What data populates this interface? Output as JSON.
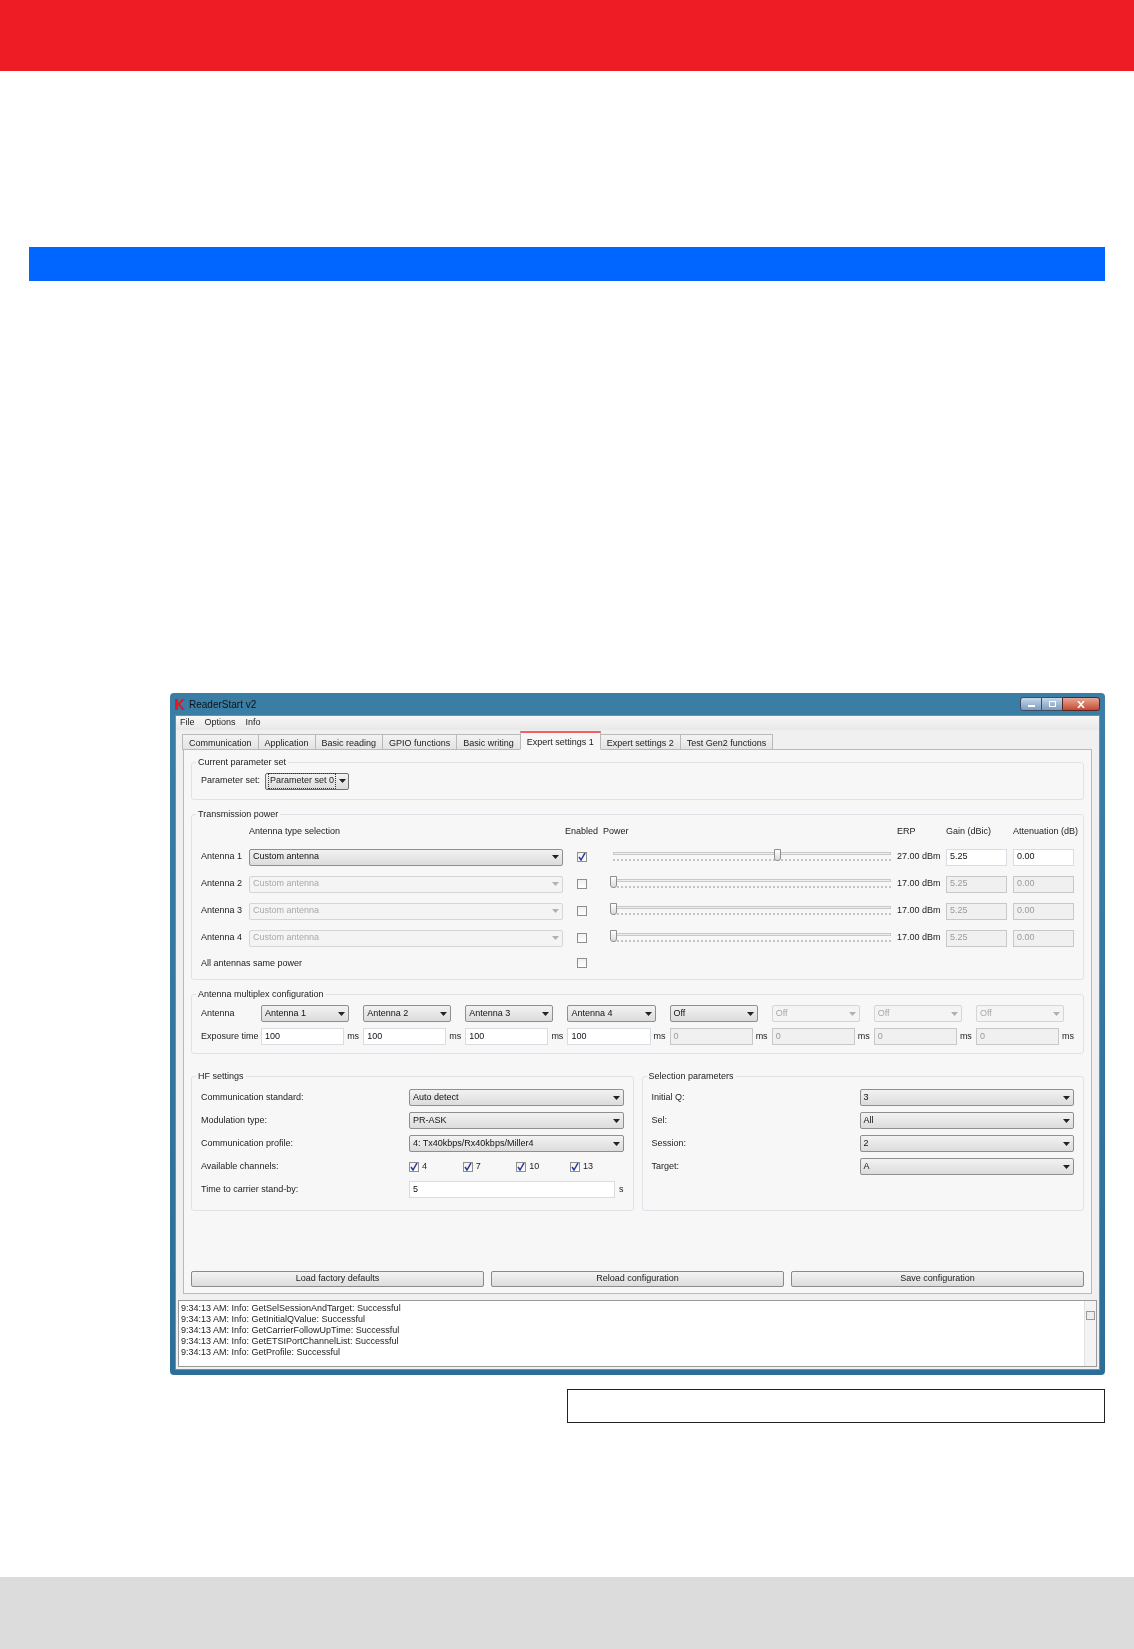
{
  "window": {
    "title": "ReaderStart v2"
  },
  "menu": [
    "File",
    "Options",
    "Info"
  ],
  "tabs": [
    {
      "label": "Communication",
      "selected": false
    },
    {
      "label": "Application",
      "selected": false
    },
    {
      "label": "Basic reading",
      "selected": false
    },
    {
      "label": "GPIO functions",
      "selected": false
    },
    {
      "label": "Basic writing",
      "selected": false
    },
    {
      "label": "Expert settings 1",
      "selected": true
    },
    {
      "label": "Expert settings 2",
      "selected": false
    },
    {
      "label": "Test Gen2 functions",
      "selected": false
    }
  ],
  "parameter_group": {
    "title": "Current parameter set",
    "label": "Parameter set:",
    "value": "Parameter set 0"
  },
  "transmission_power": {
    "title": "Transmission power",
    "headers": {
      "antenna_type": "Antenna type selection",
      "enabled": "Enabled",
      "power": "Power",
      "erp": "ERP",
      "gain": "Gain (dBic)",
      "attenuation": "Attenuation (dB)"
    },
    "antennas": [
      {
        "label": "Antenna 1",
        "type": "Custom antenna",
        "disabled": false,
        "checked": true,
        "level": 0.59,
        "erp": "27.00 dBm",
        "gain": "5.25",
        "attenuation": "0.00"
      },
      {
        "label": "Antenna 2",
        "type": "Custom antenna",
        "disabled": true,
        "checked": false,
        "level": 0,
        "erp": "17.00 dBm",
        "gain": "5.25",
        "attenuation": "0.00"
      },
      {
        "label": "Antenna 3",
        "type": "Custom antenna",
        "disabled": true,
        "checked": false,
        "level": 0,
        "erp": "17.00 dBm",
        "gain": "5.25",
        "attenuation": "0.00"
      },
      {
        "label": "Antenna 4",
        "type": "Custom antenna",
        "disabled": true,
        "checked": false,
        "level": 0,
        "erp": "17.00 dBm",
        "gain": "5.25",
        "attenuation": "0.00"
      }
    ],
    "same_power": {
      "label": "All antennas same power",
      "checked": false
    }
  },
  "multiplex": {
    "title": "Antenna multiplex configuration",
    "antenna_label": "Antenna",
    "exposure_label": "Exposure time",
    "slots": [
      {
        "antenna": "Antenna 1",
        "exposure": "100",
        "unit": "ms",
        "disabled": false,
        "exposure_disabled": false
      },
      {
        "antenna": "Antenna 2",
        "exposure": "100",
        "unit": "ms",
        "disabled": false,
        "exposure_disabled": false
      },
      {
        "antenna": "Antenna 3",
        "exposure": "100",
        "unit": "ms",
        "disabled": false,
        "exposure_disabled": false
      },
      {
        "antenna": "Antenna 4",
        "exposure": "100",
        "unit": "ms",
        "disabled": false,
        "exposure_disabled": false
      },
      {
        "antenna": "Off",
        "exposure": "0",
        "unit": "ms",
        "disabled": false,
        "exposure_disabled": true
      },
      {
        "antenna": "Off",
        "exposure": "0",
        "unit": "ms",
        "disabled": true,
        "exposure_disabled": true
      },
      {
        "antenna": "Off",
        "exposure": "0",
        "unit": "ms",
        "disabled": true,
        "exposure_disabled": true
      },
      {
        "antenna": "Off",
        "exposure": "0",
        "unit": "ms",
        "disabled": true,
        "exposure_disabled": true
      }
    ]
  },
  "hf_settings": {
    "title": "HF settings",
    "rows": [
      {
        "kind": "select",
        "label": "Communication standard:",
        "value": "Auto detect"
      },
      {
        "kind": "select",
        "label": "Modulation type:",
        "value": "PR-ASK"
      },
      {
        "kind": "select",
        "label": "Communication profile:",
        "value": "4: Tx40kbps/Rx40kbps/Miller4"
      },
      {
        "kind": "channels",
        "label": "Available channels:",
        "channels": [
          {
            "label": "4",
            "checked": true
          },
          {
            "label": "7",
            "checked": true
          },
          {
            "label": "10",
            "checked": true
          },
          {
            "label": "13",
            "checked": true
          }
        ]
      },
      {
        "kind": "text",
        "label": "Time to carrier stand-by:",
        "value": "5",
        "unit": "s"
      }
    ]
  },
  "selection_parameters": {
    "title": "Selection parameters",
    "rows": [
      {
        "kind": "select",
        "label": "Initial Q:",
        "value": "3"
      },
      {
        "kind": "select",
        "label": "Sel:",
        "value": "All"
      },
      {
        "kind": "select",
        "label": "Session:",
        "value": "2"
      },
      {
        "kind": "select",
        "label": "Target:",
        "value": "A"
      }
    ]
  },
  "buttons": [
    "Load factory defaults",
    "Reload configuration",
    "Save configuration"
  ],
  "log": [
    "9:34:13 AM: Info: GetSelSessionAndTarget: Successful",
    "9:34:13 AM: Info: GetInitialQValue: Successful",
    "9:34:13 AM: Info: GetCarrierFollowUpTime: Successful",
    "9:34:13 AM: Info: GetETSIPortChannelList: Successful",
    "9:34:13 AM: Info: GetProfile: Successful"
  ]
}
